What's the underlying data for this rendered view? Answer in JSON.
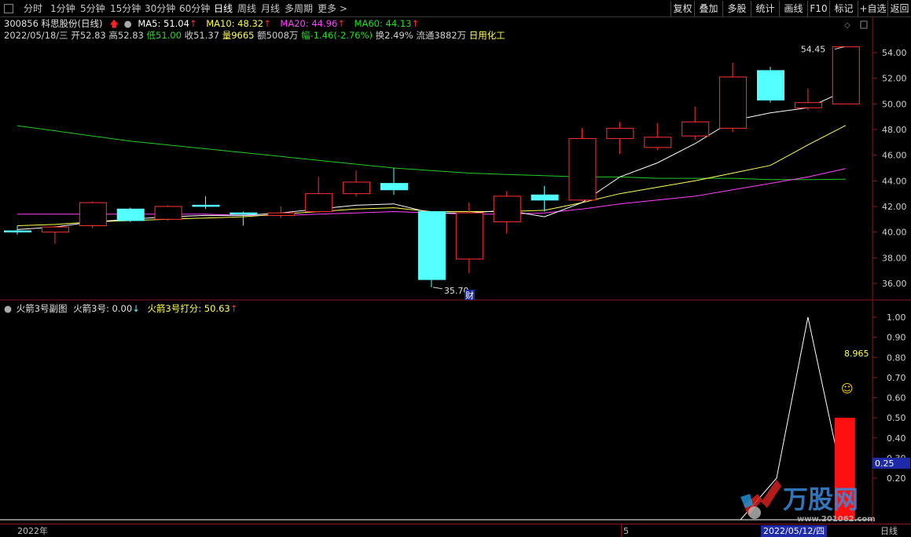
{
  "toolbar": {
    "periods": [
      "分时",
      "1分钟",
      "5分钟",
      "15分钟",
      "30分钟",
      "60分钟",
      "日线",
      "周线",
      "月线",
      "多周期",
      "更多 >"
    ],
    "active_period": "日线",
    "right_buttons": [
      "复权",
      "叠加",
      "多股",
      "统计",
      "画线",
      "F10",
      "标记",
      "+自选",
      "返回"
    ]
  },
  "stock": {
    "title": "300856 科思股份(日线)",
    "ma5": "MA5: 51.04",
    "ma10": "MA10: 48.32",
    "ma20": "MA20: 44.96",
    "ma60": "MA60: 44.13",
    "arrow_up": "↑"
  },
  "ohlc": {
    "date": "2022/05/18/三",
    "open": "开52.83",
    "high": "高52.83",
    "low": "低51.00",
    "close": "收51.37",
    "volume": "量9665",
    "amount": "额5008万",
    "change": "幅-1.46(-2.76%)",
    "turnover": "换2.49%",
    "float": "流通3882万",
    "industry": "日用化工"
  },
  "annotations": {
    "high_mark": "54.45",
    "low_mark": "35.70",
    "finance_badge": "财",
    "sub_value": "8.965",
    "smiley": "☺",
    "cursor_value": "0.25"
  },
  "sub_indicator": {
    "name": "火箭3号副图",
    "line1": "火箭3号: 0.00",
    "line1_arrow": "↓",
    "line2": "火箭3号打分: 50.63",
    "line2_arrow": "↑"
  },
  "main_axis_ticks": [
    "54.00",
    "52.00",
    "50.00",
    "48.00",
    "46.00",
    "44.00",
    "42.00",
    "40.00",
    "38.00",
    "36.00"
  ],
  "sub_axis_ticks": [
    "1.00",
    "0.90",
    "0.80",
    "0.70",
    "0.60",
    "0.50",
    "0.40",
    "0.30",
    "0.20"
  ],
  "bottom": {
    "year": "2022年",
    "month": "5",
    "cursor_date": "2022/05/12/四",
    "period_label": "日线"
  },
  "watermark": {
    "text": "万股网",
    "url": "www.201062.com"
  },
  "colors": {
    "up": "#ff3232",
    "down": "#54ffff",
    "ma5": "#ffffff",
    "ma10": "#ffff55",
    "ma20": "#ff40ff",
    "ma60": "#22cc22",
    "axis_red": "#8a1a1a"
  },
  "chart_data": {
    "type": "candlestick",
    "ylim": [
      35,
      55
    ],
    "candles": [
      {
        "o": 40.1,
        "h": 40.5,
        "l": 39.8,
        "c": 40.1,
        "dir": "flat"
      },
      {
        "o": 40.0,
        "h": 40.5,
        "l": 39.1,
        "c": 40.4,
        "dir": "up"
      },
      {
        "o": 40.5,
        "h": 42.4,
        "l": 40.3,
        "c": 42.3,
        "dir": "up"
      },
      {
        "o": 41.8,
        "h": 41.9,
        "l": 40.8,
        "c": 40.9,
        "dir": "down"
      },
      {
        "o": 41.0,
        "h": 42.1,
        "l": 40.9,
        "c": 42.0,
        "dir": "up"
      },
      {
        "o": 42.1,
        "h": 42.8,
        "l": 41.8,
        "c": 42.1,
        "dir": "flat"
      },
      {
        "o": 41.5,
        "h": 41.6,
        "l": 40.5,
        "c": 41.4,
        "dir": "down"
      },
      {
        "o": 41.3,
        "h": 42.0,
        "l": 41.1,
        "c": 41.5,
        "dir": "up"
      },
      {
        "o": 41.6,
        "h": 44.3,
        "l": 41.5,
        "c": 43.0,
        "dir": "up"
      },
      {
        "o": 43.0,
        "h": 44.8,
        "l": 42.8,
        "c": 43.9,
        "dir": "up"
      },
      {
        "o": 43.8,
        "h": 45.0,
        "l": 42.9,
        "c": 43.3,
        "dir": "down"
      },
      {
        "o": 41.6,
        "h": 41.6,
        "l": 35.7,
        "c": 36.3,
        "dir": "down"
      },
      {
        "o": 37.9,
        "h": 42.3,
        "l": 36.8,
        "c": 41.5,
        "dir": "up"
      },
      {
        "o": 40.8,
        "h": 43.2,
        "l": 39.9,
        "c": 42.8,
        "dir": "up"
      },
      {
        "o": 42.9,
        "h": 43.6,
        "l": 41.6,
        "c": 42.5,
        "dir": "down"
      },
      {
        "o": 42.5,
        "h": 48.1,
        "l": 42.4,
        "c": 47.3,
        "dir": "up"
      },
      {
        "o": 47.3,
        "h": 48.6,
        "l": 46.1,
        "c": 48.1,
        "dir": "up"
      },
      {
        "o": 46.6,
        "h": 48.5,
        "l": 46.4,
        "c": 47.4,
        "dir": "up"
      },
      {
        "o": 47.5,
        "h": 49.8,
        "l": 47.2,
        "c": 48.6,
        "dir": "up"
      },
      {
        "o": 48.1,
        "h": 53.2,
        "l": 47.8,
        "c": 52.1,
        "dir": "up"
      },
      {
        "o": 52.6,
        "h": 52.9,
        "l": 50.1,
        "c": 50.3,
        "dir": "down"
      },
      {
        "o": 49.7,
        "h": 51.2,
        "l": 49.5,
        "c": 50.1,
        "dir": "up"
      },
      {
        "o": 50.0,
        "h": 54.45,
        "l": 50.0,
        "c": 54.45,
        "dir": "up"
      }
    ],
    "ma5": [
      40.2,
      40.4,
      40.8,
      41.0,
      41.2,
      41.3,
      41.3,
      41.5,
      41.8,
      42.1,
      42.2,
      41.5,
      41.5,
      41.7,
      41.2,
      42.3,
      44.3,
      45.4,
      46.9,
      48.7,
      49.3,
      49.7,
      51.04
    ],
    "ma10": [
      40.5,
      40.6,
      40.8,
      40.9,
      41.0,
      41.1,
      41.2,
      41.4,
      41.6,
      41.8,
      41.9,
      41.6,
      41.6,
      41.6,
      41.7,
      42.3,
      43.0,
      43.5,
      44.0,
      44.6,
      45.2,
      46.8,
      48.32
    ],
    "ma20": [
      41.4,
      41.4,
      41.4,
      41.4,
      41.4,
      41.4,
      41.3,
      41.3,
      41.4,
      41.5,
      41.6,
      41.5,
      41.4,
      41.4,
      41.5,
      41.8,
      42.2,
      42.5,
      42.8,
      43.3,
      43.8,
      44.3,
      44.96
    ],
    "ma60": [
      48.3,
      47.9,
      47.5,
      47.1,
      46.8,
      46.5,
      46.2,
      45.9,
      45.6,
      45.3,
      45.0,
      44.8,
      44.6,
      44.5,
      44.4,
      44.3,
      44.3,
      44.2,
      44.2,
      44.2,
      44.1,
      44.1,
      44.13
    ],
    "sub": {
      "ylim": [
        0,
        1.05
      ],
      "line": [
        0,
        0,
        0,
        0,
        0,
        0,
        0,
        0,
        0,
        0,
        0,
        0,
        0,
        0,
        0,
        0,
        0,
        0,
        0,
        0,
        0,
        1.0,
        0.0
      ],
      "bar_last": 0.5
    }
  }
}
